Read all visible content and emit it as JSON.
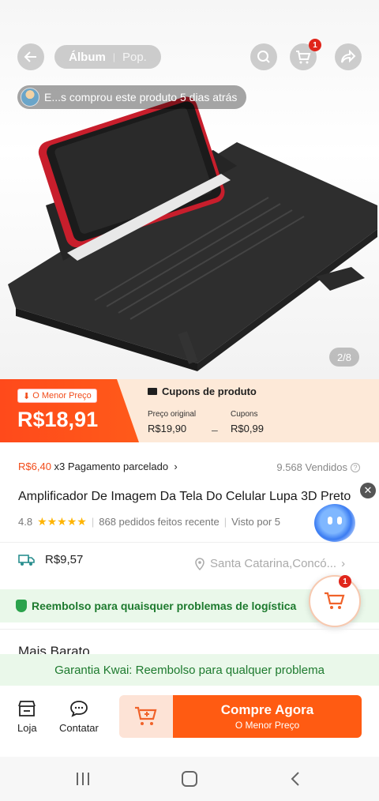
{
  "header": {
    "tab_album": "Álbum",
    "tab_pop": "Pop.",
    "cart_badge": "1",
    "buyer_notice": "E...s comprou este produto 5 dias atrás",
    "image_counter": "2/8"
  },
  "price": {
    "lowest_tag": "O Menor Preço",
    "current": "R$18,91",
    "coupon_title": "Cupons de produto",
    "original_label": "Preço original",
    "original_value": "R$19,90",
    "coupon_label": "Cupons",
    "coupon_value": "R$0,99"
  },
  "installment": {
    "amount": "R$6,40",
    "text": "x3 Pagamento parcelado",
    "sold": "9.568 Vendidos"
  },
  "product": {
    "title": "Amplificador De Imagem Da Tela Do Celular Lupa 3D Preto",
    "rating": "4.8",
    "orders": "868 pedidos feitos recente",
    "viewed": "Visto por 5"
  },
  "shipping": {
    "price": "R$9,57",
    "location": "Santa Catarina,Concó..."
  },
  "refund": {
    "text": "Reembolso para quaisquer problemas de logística",
    "float_cart_badge": "1"
  },
  "section": {
    "more_cheap": "Mais Barato",
    "guarantee": "Garantia Kwai: Reembolso para qualquer problema"
  },
  "bottom": {
    "store_label": "Loja",
    "contact_label": "Contatar",
    "buy_label": "Compre Agora",
    "buy_sub": "O Menor Preço"
  },
  "colors": {
    "accent": "#ff5b12",
    "green": "#1d7a2e"
  }
}
